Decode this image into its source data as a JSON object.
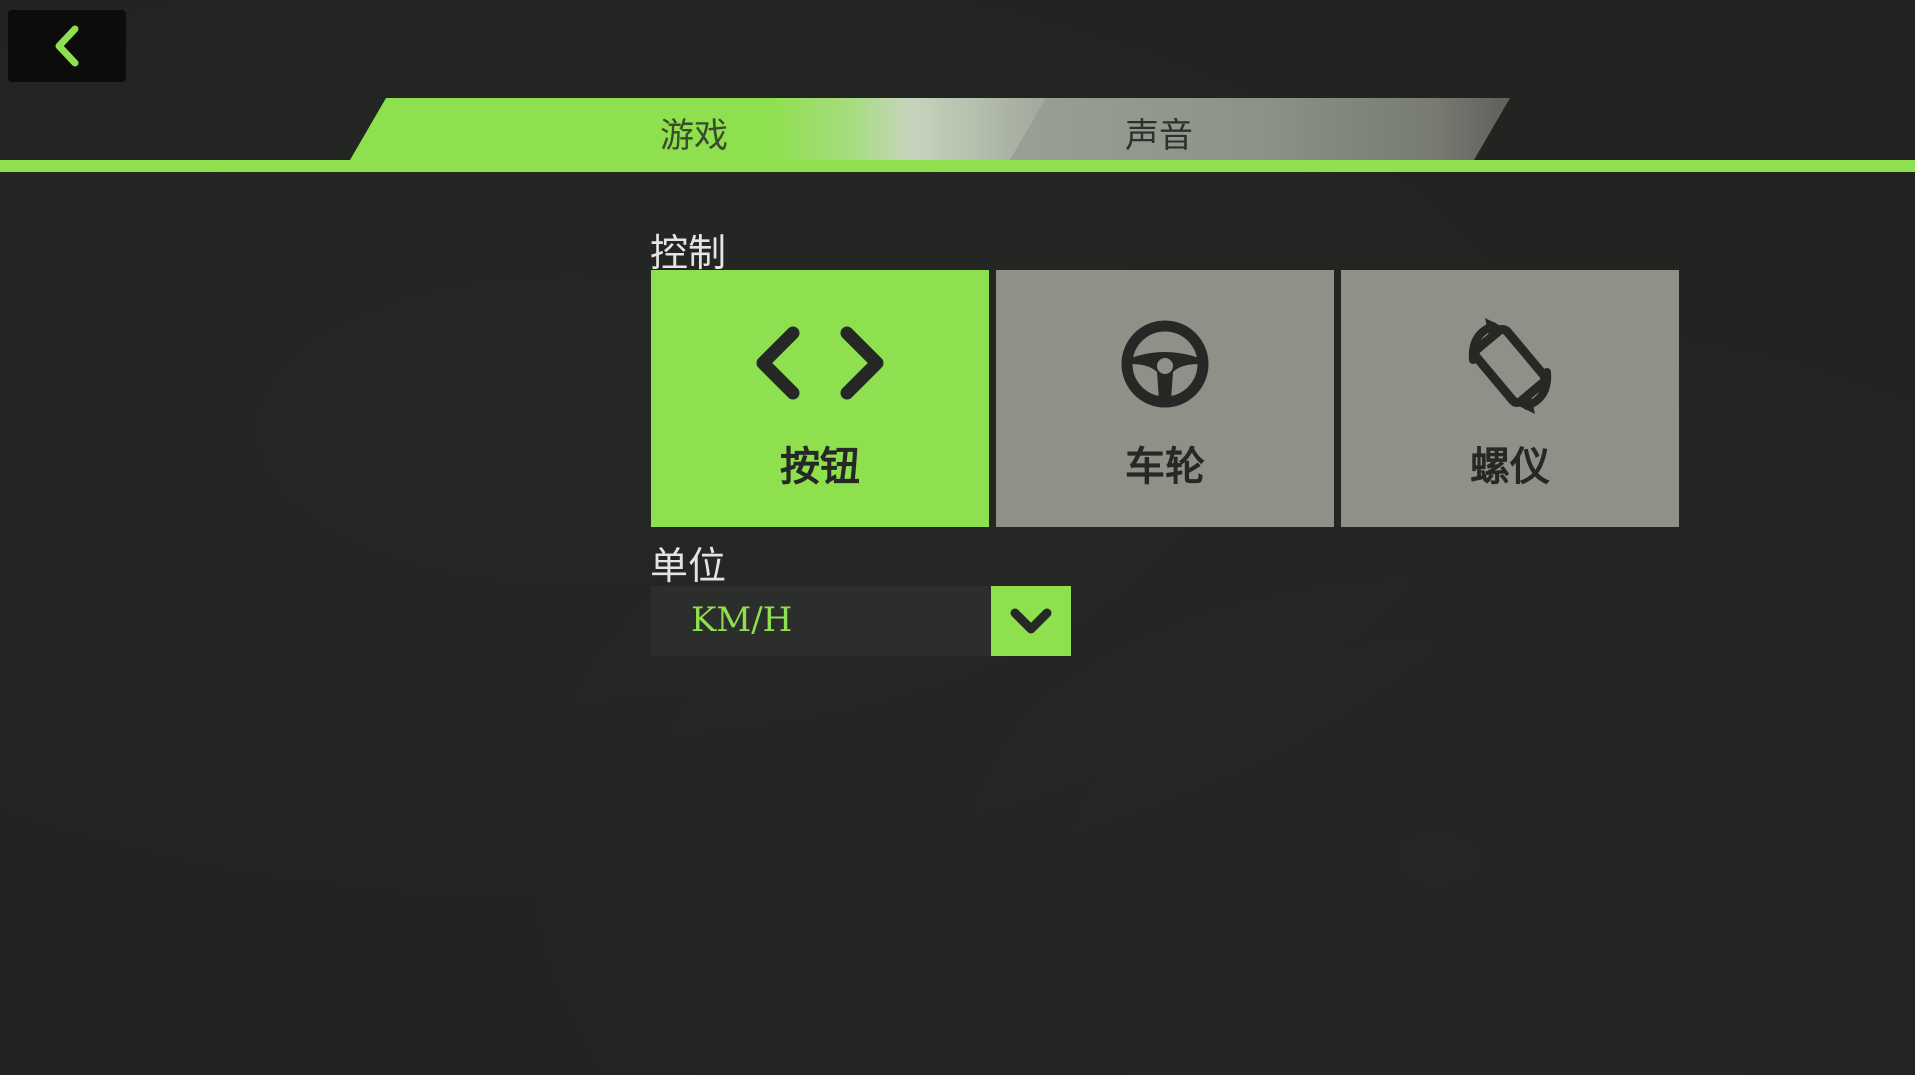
{
  "tabs": [
    {
      "label": "游戏",
      "active": true
    },
    {
      "label": "声音",
      "active": false
    }
  ],
  "control": {
    "label": "控制",
    "options": [
      {
        "label": "按钮",
        "icon": "left-right-arrows-icon",
        "selected": true
      },
      {
        "label": "车轮",
        "icon": "steering-wheel-icon",
        "selected": false
      },
      {
        "label": "螺仪",
        "icon": "rotate-device-icon",
        "selected": false
      }
    ]
  },
  "unit": {
    "label": "单位",
    "value": "KM/H"
  },
  "colors": {
    "accent": "#8ee04e",
    "inactive": "#8d9187",
    "background": "#222422"
  }
}
